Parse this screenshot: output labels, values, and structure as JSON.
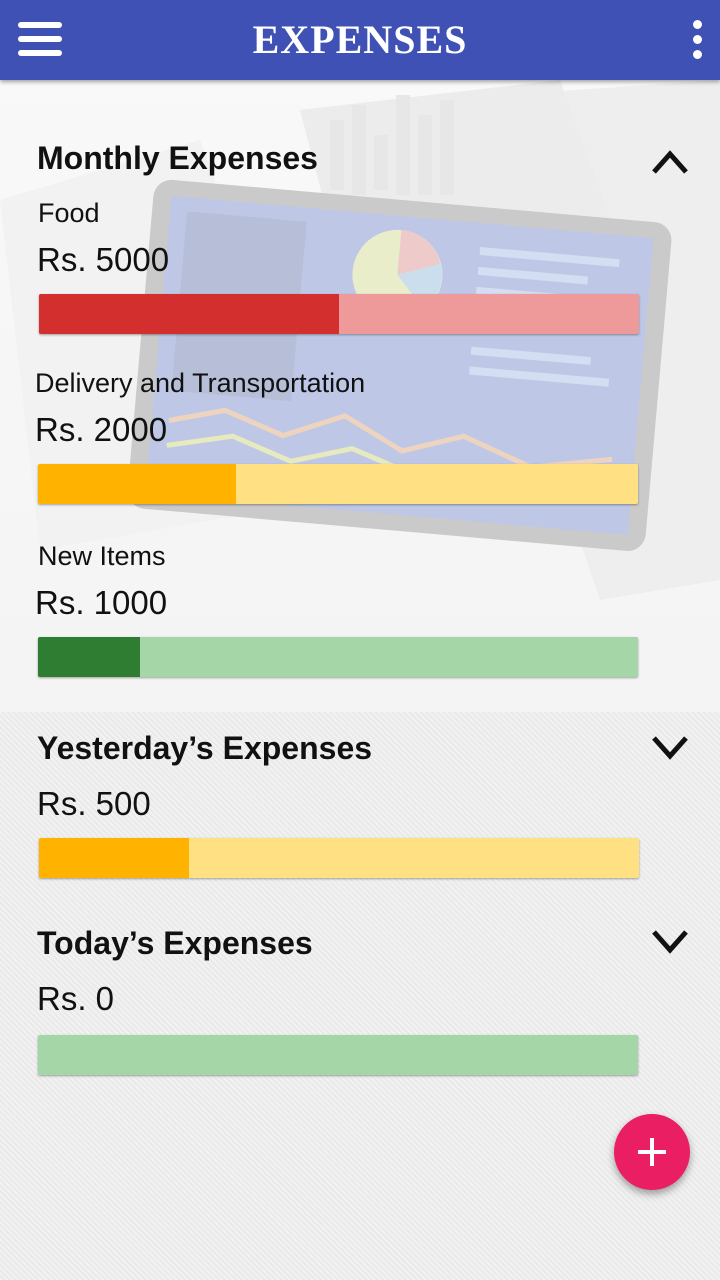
{
  "appbar": {
    "title": "EXPENSES",
    "menu_icon": "menu-icon",
    "more_icon": "more-vert-icon"
  },
  "monthly": {
    "title": "Monthly Expenses",
    "toggle_icon": "chevron-up-icon",
    "items": [
      {
        "label": "Food",
        "amount": "Rs. 5000",
        "progress": 0.5,
        "fill_color": "#d32f2f",
        "track_color": "#ef9a9a"
      },
      {
        "label": "Delivery and Transportation",
        "amount": "Rs. 2000",
        "progress": 0.33,
        "fill_color": "#ffb300",
        "track_color": "#ffe082"
      },
      {
        "label": "New Items",
        "amount": "Rs. 1000",
        "progress": 0.17,
        "fill_color": "#2e7d32",
        "track_color": "#a5d6a7"
      }
    ]
  },
  "yesterday": {
    "title": "Yesterday’s Expenses",
    "toggle_icon": "chevron-down-icon",
    "amount": "Rs. 500",
    "progress": 0.25,
    "fill_color": "#ffb300",
    "track_color": "#ffe082"
  },
  "today": {
    "title": "Today’s Expenses",
    "toggle_icon": "chevron-down-icon",
    "amount": "Rs. 0",
    "progress": 0.0,
    "fill_color": "#2e7d32",
    "track_color": "#a5d6a7"
  },
  "fab": {
    "icon": "plus-icon"
  }
}
